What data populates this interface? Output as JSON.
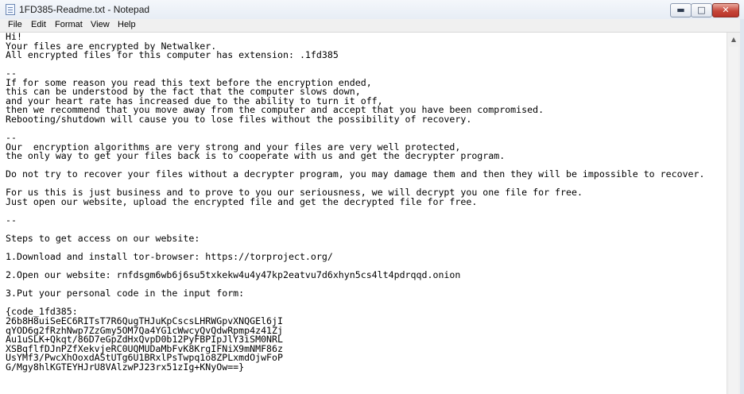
{
  "window": {
    "title": "1FD385-Readme.txt - Notepad",
    "controls": {
      "minimize": "▬",
      "maximize": "□",
      "close": "✕"
    }
  },
  "menu": {
    "items": [
      "File",
      "Edit",
      "Format",
      "View",
      "Help"
    ]
  },
  "editor": {
    "text": "Hi!\nYour files are encrypted by Netwalker.\nAll encrypted files for this computer has extension: .1fd385\n\n--\nIf for some reason you read this text before the encryption ended,\nthis can be understood by the fact that the computer slows down,\nand your heart rate has increased due to the ability to turn it off,\nthen we recommend that you move away from the computer and accept that you have been compromised.\nRebooting/shutdown will cause you to lose files without the possibility of recovery.\n\n--\nOur  encryption algorithms are very strong and your files are very well protected,\nthe only way to get your files back is to cooperate with us and get the decrypter program.\n\nDo not try to recover your files without a decrypter program, you may damage them and then they will be impossible to recover.\n\nFor us this is just business and to prove to you our seriousness, we will decrypt you one file for free.\nJust open our website, upload the encrypted file and get the decrypted file for free.\n\n--\n\nSteps to get access on our website:\n\n1.Download and install tor-browser: https://torproject.org/\n\n2.Open our website: rnfdsgm6wb6j6su5txkekw4u4y47kp2eatvu7d6xhyn5cs4lt4pdrqqd.onion\n\n3.Put your personal code in the input form:\n\n{code_1fd385:\n26b8H8uiSeEC6RITsT7R6QugTHJuKpCscsLHRWGpvXNQGEl6jI\nqYOD6g2fRzhNwp7ZzGmy5OM7Qa4YG1cWwcyQvQdwRpmp4z41Zj\nAu1uSLK+Qkqt/86D7eGpZdHxQvpD0b12PyFBPIpJlY3iSM0NRL\nXSBqflfDJnPZfXekvjeRC0UQMUDaMbFvK8KrgIFNiX9mNMF86z\nUsYMf3/PwcXhOoxdAStUTg6U1BRxlPsTwpq1o8ZPLxmdOjwFoP\nG/Mgy8hlKGTEYHJrU8VAlzwPJ23rx51zIg+KNyOw==}"
  },
  "scrollbar": {
    "up_arrow": "▲"
  }
}
